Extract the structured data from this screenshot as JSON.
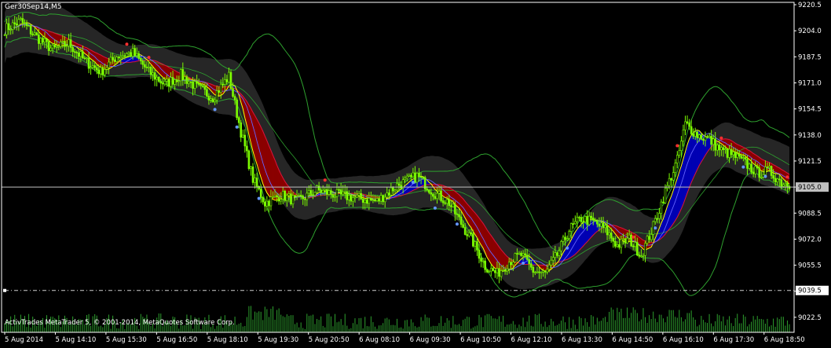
{
  "symbol_label": "Ger30Sep14,M5",
  "copyright": "ActivTrades MetaTrader 5, © 2001-2014, MetaQuotes Software Corp.",
  "colors": {
    "background": "#000000",
    "frame": "#ffffff",
    "candle": "#7cfc00",
    "volume": "#2ea02e",
    "cloud_bearish": "#8b0000",
    "cloud_bullish": "#0000b4",
    "band_shadow": "#2a2a2a",
    "bollinger": "#2ea02e",
    "ma_fast": "#ffff00",
    "ma_slow": "#dc143c",
    "ma_blue": "#6464ff",
    "price_line": "#c0c0c0"
  },
  "chart_data": {
    "type": "candlestick",
    "instrument": "Ger30Sep14",
    "timeframe": "M5",
    "ylim": [
      9013,
      9222
    ],
    "y_ticks": [
      "9220.5",
      "9204.0",
      "9187.5",
      "9171.0",
      "9154.5",
      "9138.0",
      "9121.5",
      "9105.0",
      "9088.5",
      "9072.0",
      "9055.5",
      "9039.0",
      "9022.5"
    ],
    "x_ticks": [
      "5 Aug 2014",
      "5 Aug 14:10",
      "5 Aug 15:30",
      "5 Aug 16:50",
      "5 Aug 18:10",
      "5 Aug 19:30",
      "5 Aug 20:50",
      "6 Aug 08:10",
      "6 Aug 09:30",
      "6 Aug 10:50",
      "6 Aug 12:10",
      "6 Aug 13:30",
      "6 Aug 14:50",
      "6 Aug 16:10",
      "6 Aug 17:30",
      "6 Aug 18:50"
    ],
    "current_price": "9105.0",
    "level_line": "9039.5",
    "price_path": [
      [
        0,
        9205
      ],
      [
        8,
        9210
      ],
      [
        16,
        9200
      ],
      [
        24,
        9192
      ],
      [
        32,
        9196
      ],
      [
        40,
        9185
      ],
      [
        48,
        9178
      ],
      [
        56,
        9188
      ],
      [
        64,
        9190
      ],
      [
        72,
        9178
      ],
      [
        80,
        9170
      ],
      [
        88,
        9176
      ],
      [
        96,
        9168
      ],
      [
        104,
        9162
      ],
      [
        112,
        9175
      ],
      [
        118,
        9140
      ],
      [
        124,
        9110
      ],
      [
        130,
        9095
      ],
      [
        138,
        9100
      ],
      [
        146,
        9096
      ],
      [
        156,
        9103
      ],
      [
        166,
        9100
      ],
      [
        176,
        9098
      ],
      [
        186,
        9096
      ],
      [
        196,
        9106
      ],
      [
        206,
        9112
      ],
      [
        214,
        9102
      ],
      [
        222,
        9095
      ],
      [
        228,
        9082
      ],
      [
        234,
        9070
      ],
      [
        240,
        9055
      ],
      [
        246,
        9050
      ],
      [
        252,
        9058
      ],
      [
        258,
        9062
      ],
      [
        264,
        9052
      ],
      [
        270,
        9050
      ],
      [
        276,
        9062
      ],
      [
        282,
        9078
      ],
      [
        288,
        9085
      ],
      [
        294,
        9083
      ],
      [
        300,
        9078
      ],
      [
        306,
        9068
      ],
      [
        312,
        9072
      ],
      [
        318,
        9062
      ],
      [
        324,
        9080
      ],
      [
        330,
        9102
      ],
      [
        336,
        9122
      ],
      [
        340,
        9145
      ],
      [
        346,
        9138
      ],
      [
        352,
        9135
      ],
      [
        358,
        9128
      ],
      [
        364,
        9125
      ],
      [
        370,
        9120
      ],
      [
        376,
        9114
      ],
      [
        382,
        9115
      ],
      [
        388,
        9108
      ],
      [
        392,
        9107
      ]
    ]
  }
}
